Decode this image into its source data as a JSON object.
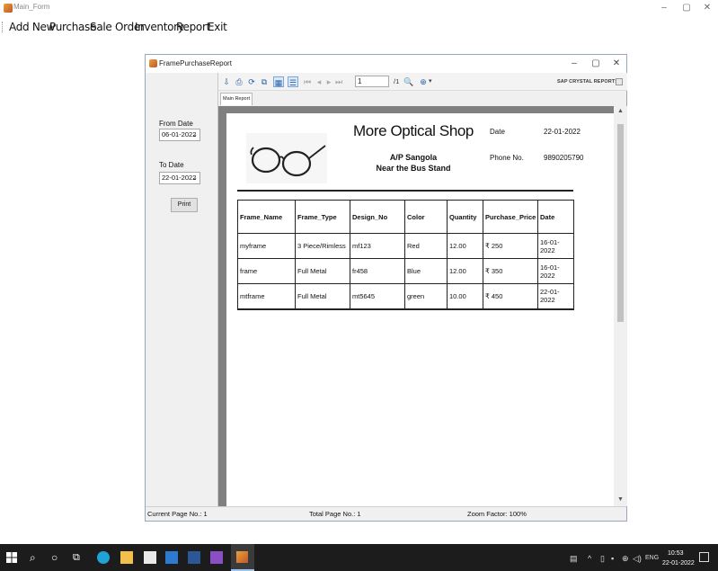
{
  "main_window": {
    "title": "Main_Form",
    "controls": {
      "minimize": "–",
      "maximize": "▢",
      "close": "✕"
    }
  },
  "menubar": {
    "items": [
      "Add New",
      "Purchase",
      "Sale Order",
      "Inventory",
      "Report",
      "Exit"
    ]
  },
  "child_window": {
    "title": "FramePurchaseReport",
    "controls": {
      "minimize": "–",
      "maximize": "▢",
      "close": "✕"
    }
  },
  "parameters": {
    "from_label": "From Date",
    "from_value": "06-01-2022",
    "to_label": "To Date",
    "to_value": "22-01-2022",
    "print_label": "Print"
  },
  "viewer_toolbar": {
    "page_value": "1",
    "page_total": "/1",
    "brand": "SAP CRYSTAL REPORTS®",
    "icons": [
      "export-icon",
      "print-icon",
      "refresh-icon",
      "copy-icon",
      "toggle-parameter-panel-icon",
      "toggle-group-tree-icon",
      "first-page-icon",
      "previous-page-icon",
      "next-page-icon",
      "last-page-icon",
      "find-icon",
      "zoom-icon"
    ]
  },
  "tabs": [
    "Main Report"
  ],
  "report": {
    "shop_name": "More Optical Shop",
    "address_line1": "A/P Sangola",
    "address_line2": "Near the Bus Stand",
    "date_label": "Date",
    "date_value": "22-01-2022",
    "phone_label": "Phone No.",
    "phone_value": "9890205790",
    "columns": [
      "Frame_Name",
      "Frame_Type",
      "Design_No",
      "Color",
      "Quantity",
      "Purchase_Price",
      "Date"
    ],
    "rows": [
      [
        "myframe",
        "3 Piece/Rimless",
        "mf123",
        "Red",
        "12.00",
        "₹  250",
        "16-01-2022"
      ],
      [
        "frame",
        "Full Metal",
        "fr458",
        "Blue",
        "12.00",
        "₹  350",
        "16-01-2022"
      ],
      [
        "mtframe",
        "Full Metal",
        "mt5645",
        "green",
        "10.00",
        "₹  450",
        "22-01-2022"
      ]
    ]
  },
  "statusbar": {
    "current_page": "Current Page No.: 1",
    "total_page": "Total Page No.: 1",
    "zoom": "Zoom Factor: 100%"
  },
  "taskbar": {
    "time": "10:53",
    "date": "22-01-2022",
    "lang": "ENG"
  },
  "colors": {
    "taskbar_bg": "#1c1c1c",
    "report_bg": "#808080",
    "window_bg": "#f0f0f0"
  }
}
